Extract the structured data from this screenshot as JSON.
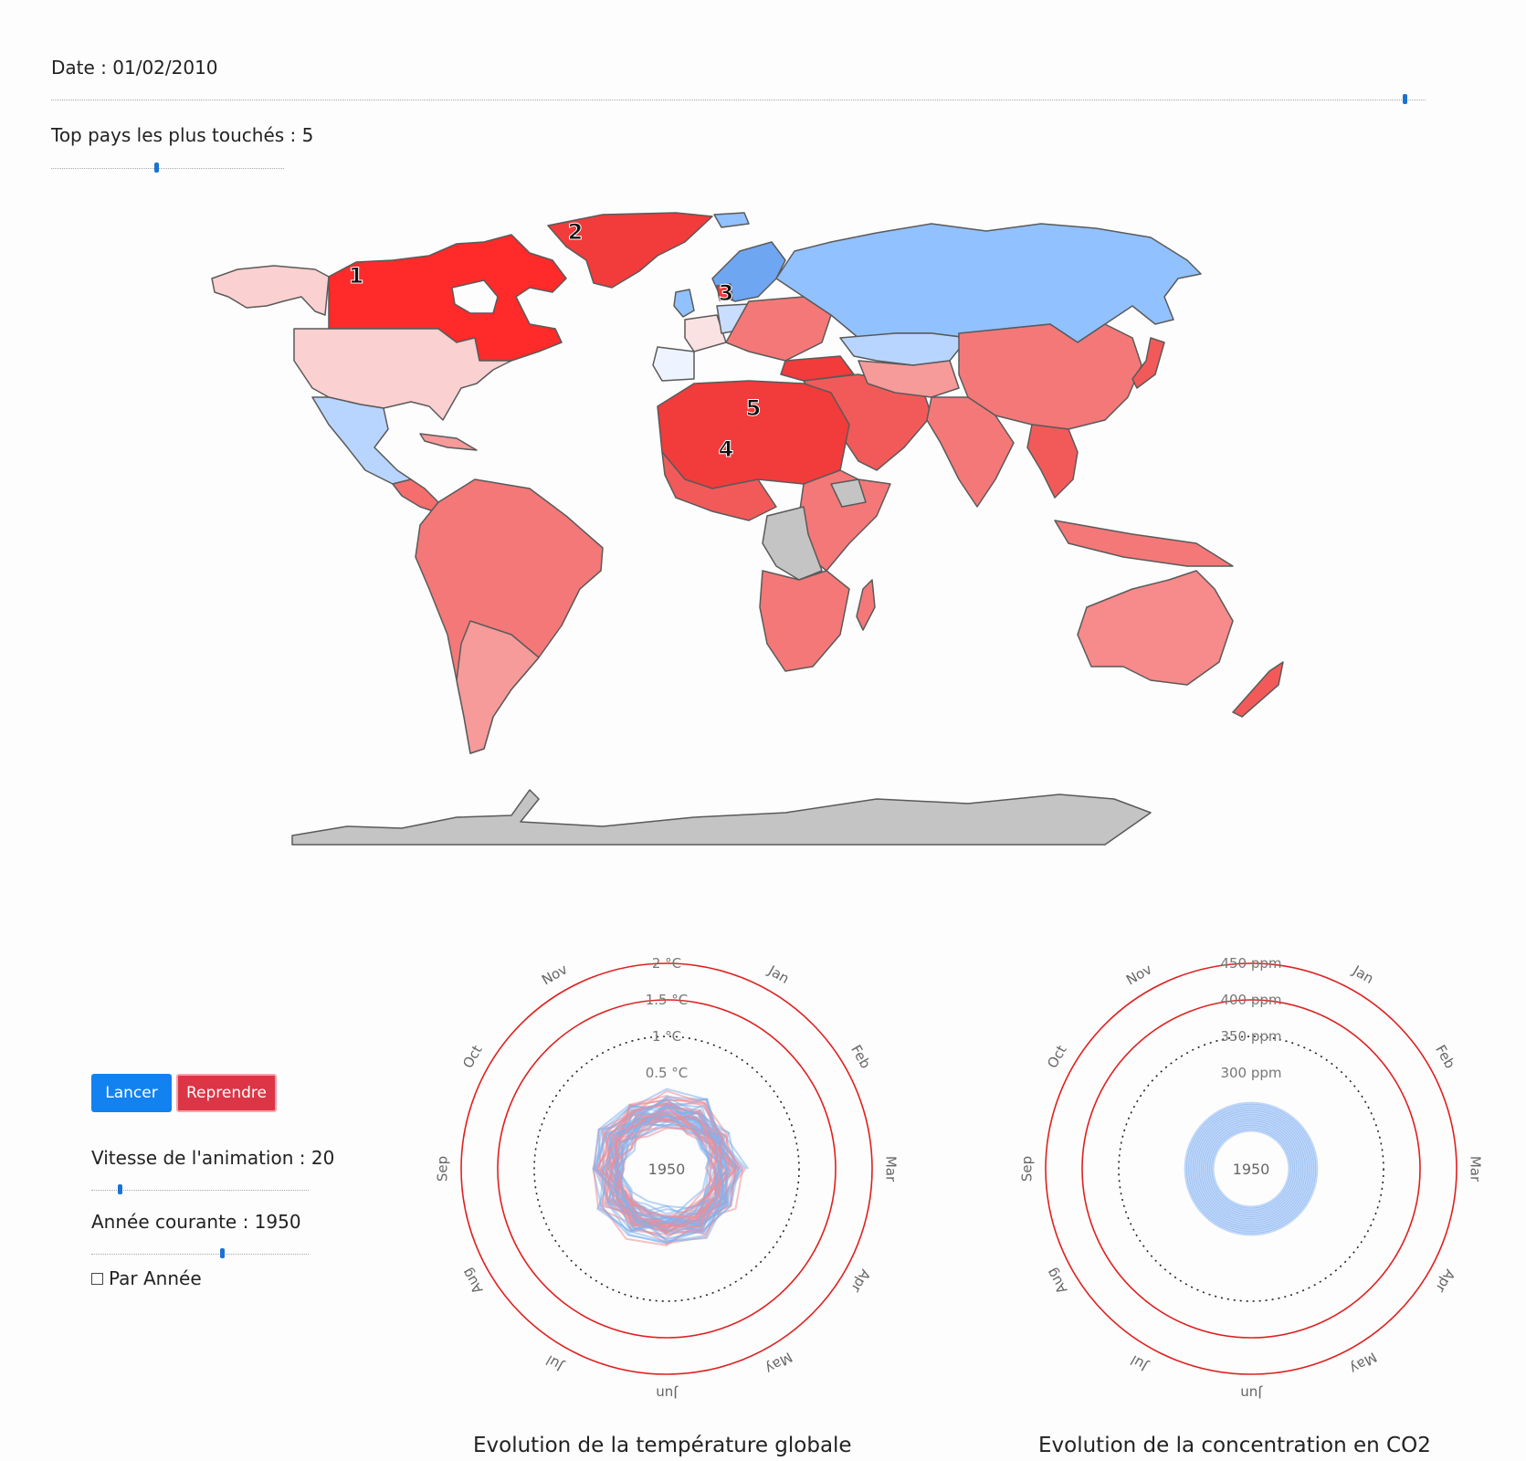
{
  "date_label": "Date : 01/02/2010",
  "top_label": "Top pays les plus touchés : 5",
  "sliders": {
    "date_fraction": 0.985,
    "top_fraction": 0.45,
    "speed_fraction": 0.13,
    "year_fraction": 0.6
  },
  "map": {
    "ranks": [
      "1",
      "2",
      "3",
      "4",
      "5"
    ],
    "colors": {
      "hot": "#ff2a2a",
      "warm": "#f56e6e",
      "mild": "#f79a9a",
      "light": "#fbd0d0",
      "cold": "#92c1ff",
      "cool": "#b8d5ff",
      "nodata": "#c4c4c4",
      "border": "#5a5a5a"
    }
  },
  "controls": {
    "launch_label": "Lancer",
    "resume_label": "Reprendre",
    "speed_label": "Vitesse de l'animation : 20",
    "year_label": "Année courante : 1950",
    "per_year_label": "Par Année"
  },
  "temperature_chart": {
    "title": "Evolution de la température globale",
    "center_label": "1950",
    "months": [
      "Jan",
      "Feb",
      "Mar",
      "Apr",
      "May",
      "Jun",
      "Jul",
      "Aug",
      "Sep",
      "Oct",
      "Nov"
    ],
    "rings": [
      {
        "label": "2 °C",
        "style": "solid"
      },
      {
        "label": "1.5 °C",
        "style": "solid"
      },
      {
        "label": "1 °C",
        "style": "dotted"
      },
      {
        "label": "0.5 °C",
        "style": "none"
      }
    ],
    "ring_values": [
      2,
      1.5,
      1,
      0.5
    ],
    "colors": {
      "cold": "#7fb3ef",
      "warm": "#f08c96",
      "ring": "#e02020"
    }
  },
  "co2_chart": {
    "title": "Evolution de la concentration en CO2",
    "center_label": "1950",
    "months": [
      "Jan",
      "Feb",
      "Mar",
      "Apr",
      "May",
      "Jun",
      "Jul",
      "Aug",
      "Sep",
      "Oct",
      "Nov"
    ],
    "rings": [
      {
        "label": "450 ppm",
        "style": "solid"
      },
      {
        "label": "400 ppm",
        "style": "solid"
      },
      {
        "label": "350 ppm",
        "style": "dotted"
      },
      {
        "label": "300 ppm",
        "style": "none"
      }
    ],
    "ring_values": [
      450,
      400,
      350,
      300
    ],
    "colors": {
      "fill": "#4a90ee",
      "ring": "#e02020"
    }
  }
}
